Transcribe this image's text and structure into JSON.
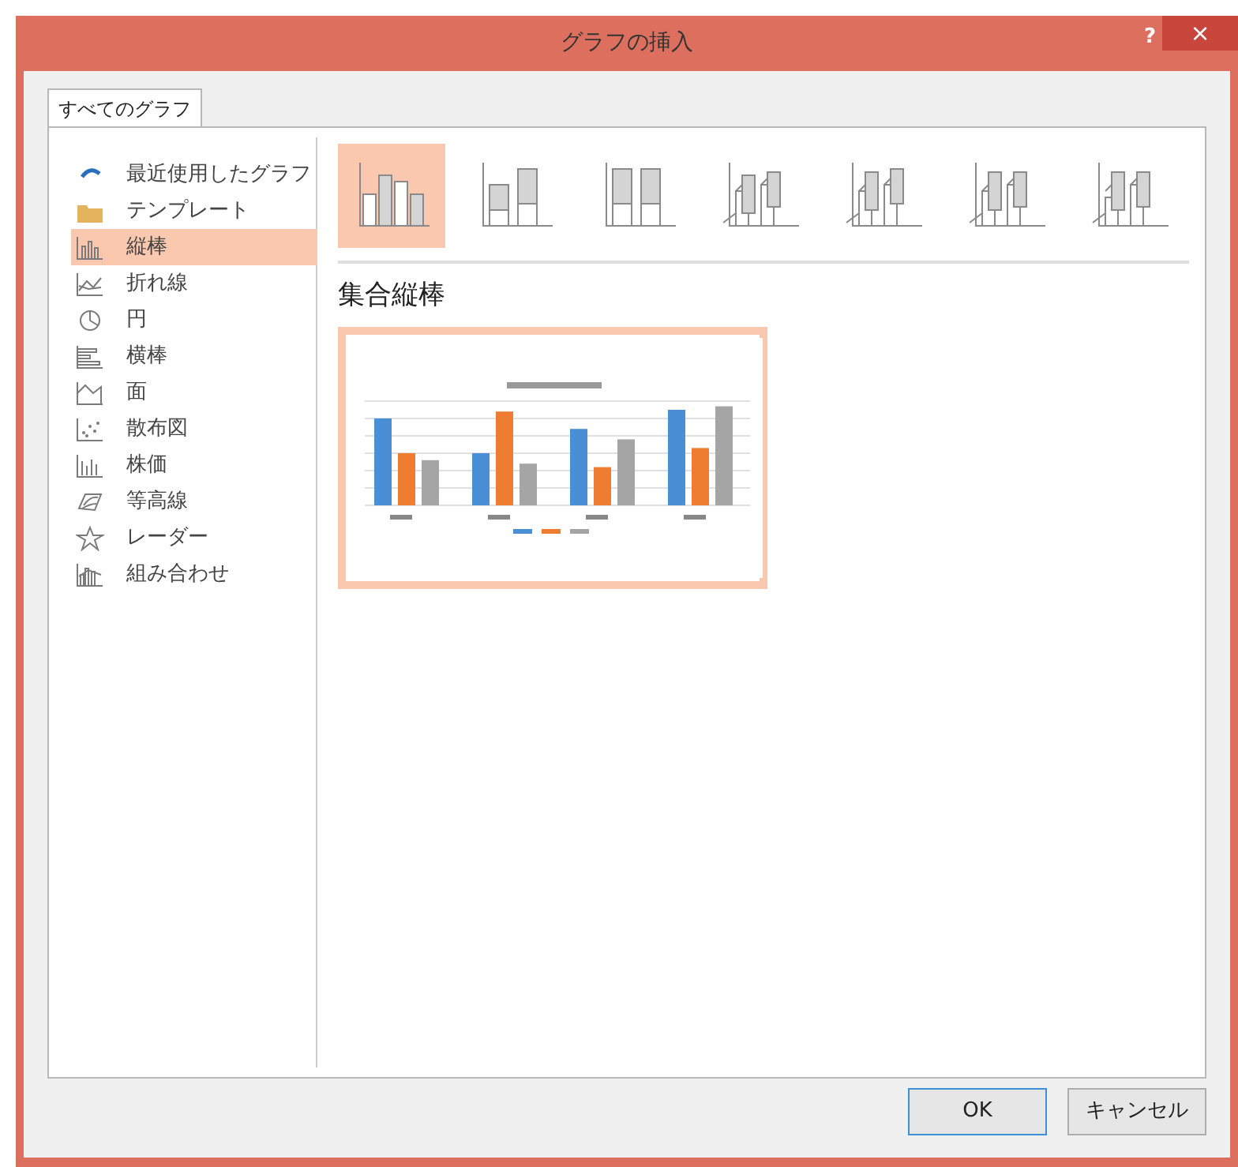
{
  "window": {
    "title": "グラフの挿入",
    "help": "?",
    "close": "×"
  },
  "tabs": [
    {
      "label": "すべてのグラフ",
      "selected": true
    }
  ],
  "categories": [
    {
      "label": "最近使用したグラフ",
      "selected": false
    },
    {
      "label": "テンプレート",
      "selected": false
    },
    {
      "label": "縦棒",
      "selected": true
    },
    {
      "label": "折れ線",
      "selected": false
    },
    {
      "label": "円",
      "selected": false
    },
    {
      "label": "横棒",
      "selected": false
    },
    {
      "label": "面",
      "selected": false
    },
    {
      "label": "散布図",
      "selected": false
    },
    {
      "label": "株価",
      "selected": false
    },
    {
      "label": "等高線",
      "selected": false
    },
    {
      "label": "レーダー",
      "selected": false
    },
    {
      "label": "組み合わせ",
      "selected": false
    }
  ],
  "subtypes": [
    {
      "selected": true
    },
    {
      "selected": false
    },
    {
      "selected": false
    },
    {
      "selected": false
    },
    {
      "selected": false
    },
    {
      "selected": false
    },
    {
      "selected": false
    }
  ],
  "subtype_title": "集合縦棒",
  "buttons": [
    {
      "label": "OK",
      "kind": "default"
    },
    {
      "label": "キャンセル",
      "kind": "normal"
    }
  ]
}
